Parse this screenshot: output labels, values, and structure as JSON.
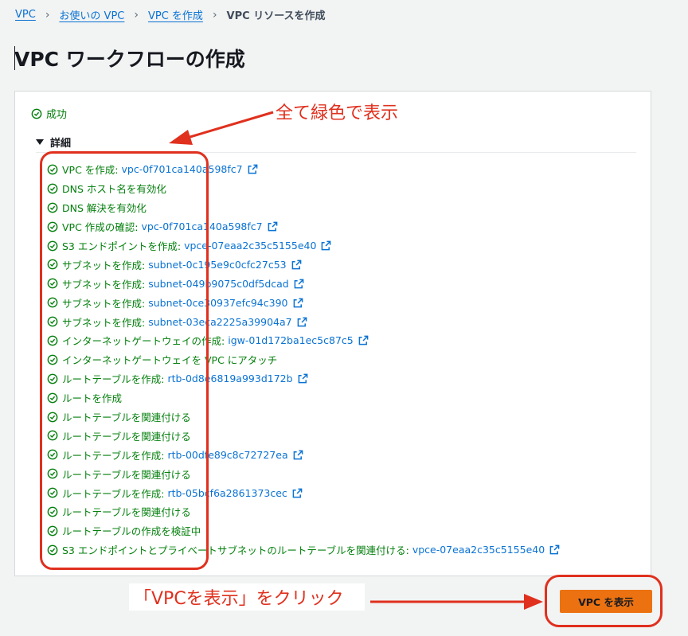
{
  "breadcrumb": {
    "items": [
      "VPC",
      "お使いの VPC",
      "VPC を作成"
    ],
    "current": "VPC リソースを作成"
  },
  "page_title": "VPC ワークフローの作成",
  "status": {
    "label": "成功",
    "color": "#037f0c"
  },
  "details": {
    "label": "詳細",
    "steps": [
      {
        "text": "VPC を作成:",
        "id": "vpc-0f701ca140a598fc7"
      },
      {
        "text": "DNS ホスト名を有効化"
      },
      {
        "text": "DNS 解決を有効化"
      },
      {
        "text": "VPC 作成の確認:",
        "id": "vpc-0f701ca140a598fc7"
      },
      {
        "text": "S3 エンドポイントを作成:",
        "id": "vpce-07eaa2c35c5155e40"
      },
      {
        "text": "サブネットを作成:",
        "id": "subnet-0c195e9c0cfc27c53"
      },
      {
        "text": "サブネットを作成:",
        "id": "subnet-049b9075c0df5dcad"
      },
      {
        "text": "サブネットを作成:",
        "id": "subnet-0ce30937efc94c390"
      },
      {
        "text": "サブネットを作成:",
        "id": "subnet-03eca2225a39904a7"
      },
      {
        "text": "インターネットゲートウェイの作成:",
        "id": "igw-01d172ba1ec5c87c5"
      },
      {
        "text": "インターネットゲートウェイを VPC にアタッチ"
      },
      {
        "text": "ルートテーブルを作成:",
        "id": "rtb-0d8e6819a993d172b"
      },
      {
        "text": "ルートを作成"
      },
      {
        "text": "ルートテーブルを関連付ける"
      },
      {
        "text": "ルートテーブルを関連付ける"
      },
      {
        "text": "ルートテーブルを作成:",
        "id": "rtb-00dfe89c8c72727ea"
      },
      {
        "text": "ルートテーブルを関連付ける"
      },
      {
        "text": "ルートテーブルを作成:",
        "id": "rtb-05bcf6a2861373cec"
      },
      {
        "text": "ルートテーブルを関連付ける"
      },
      {
        "text": "ルートテーブルの作成を検証中"
      },
      {
        "text": "S3 エンドポイントとプライベートサブネットのルートテーブルを関連付ける:",
        "id": "vpce-07eaa2c35c5155e40"
      }
    ]
  },
  "annotations": {
    "all_green": "全て緑色で表示",
    "click_hint": "「VPCを表示」をクリック",
    "color": "#e0301e"
  },
  "actions": {
    "view_vpc": "VPC を表示"
  },
  "icons": {
    "check": "check-circle-icon",
    "external": "external-link-icon",
    "caret": "caret-down-icon"
  },
  "colors": {
    "link": "#0972d3",
    "success": "#037f0c",
    "primary_button": "#ec7211"
  }
}
